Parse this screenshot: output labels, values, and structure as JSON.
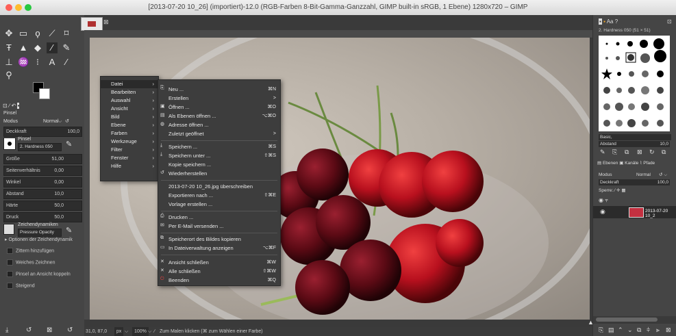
{
  "window": {
    "title": "[2013-07-20 10_26] (importiert)-12.0 (RGB-Farben 8-Bit-Gamma-Ganzzahl, GIMP built-in sRGB, 1 Ebene) 1280x720 – GIMP"
  },
  "tool_options": {
    "tool_name": "Pinsel",
    "mode_label": "Modus",
    "mode_value": "Normal",
    "opacity_label": "Deckkraft",
    "opacity_value": "100,0",
    "brush_label": "Pinsel",
    "brush_value": "2. Hardness 050",
    "rows": [
      {
        "label": "Größe",
        "value": "51,00"
      },
      {
        "label": "Seitenverhältnis",
        "value": "0,00"
      },
      {
        "label": "Winkel",
        "value": "0,00"
      },
      {
        "label": "Abstand",
        "value": "10,0"
      },
      {
        "label": "Härte",
        "value": "50,0"
      },
      {
        "label": "Druck",
        "value": "50,0"
      }
    ],
    "dynamics_label": "Zeichendynamiken",
    "dynamics_value": "Pressure Opacity",
    "options": [
      "Optionen der Zeichendynamik",
      "Zittern hinzufügen",
      "Weiches Zeichnen",
      "Pinsel an Ansicht koppeln",
      "Steigend"
    ]
  },
  "main_menu": {
    "items": [
      "Datei",
      "Bearbeiten",
      "Auswahl",
      "Ansicht",
      "Bild",
      "Ebene",
      "Farben",
      "Werkzeuge",
      "Filter",
      "Fenster",
      "Hilfe"
    ]
  },
  "file_menu": {
    "items": [
      {
        "label": "Neu ...",
        "key": "⌘N"
      },
      {
        "label": "Erstellen",
        "key": ">"
      },
      {
        "label": "Öffnen ...",
        "key": "⌘O"
      },
      {
        "label": "Als Ebenen öffnen ...",
        "key": "⌥⌘O"
      },
      {
        "label": "Adresse öffnen ...",
        "key": ""
      },
      {
        "label": "Zuletzt geöffnet",
        "key": ">"
      },
      {
        "label": "Speichern ...",
        "key": "⌘S"
      },
      {
        "label": "Speichern unter ...",
        "key": "⇧⌘S"
      },
      {
        "label": "Kopie speichern ...",
        "key": ""
      },
      {
        "label": "Wiederherstellen",
        "key": ""
      },
      {
        "label": "2013-07-20 10_26.jpg überschreiben",
        "key": ""
      },
      {
        "label": "Exportieren nach ...",
        "key": "⇧⌘E"
      },
      {
        "label": "Vorlage erstellen ...",
        "key": ""
      },
      {
        "label": "Drucken ...",
        "key": ""
      },
      {
        "label": "Per E-Mail versenden ...",
        "key": ""
      },
      {
        "label": "Speicherort des Bildes kopieren",
        "key": ""
      },
      {
        "label": "In Dateiverwaltung anzeigen",
        "key": "⌥⌘F"
      },
      {
        "label": "Ansicht schließen",
        "key": "⌘W"
      },
      {
        "label": "Alle schließen",
        "key": "⇧⌘W"
      },
      {
        "label": "Beenden",
        "key": "⌘Q"
      }
    ]
  },
  "brushes": {
    "header": "2. Hardness 050 (51 × 51)",
    "tag_label": "Basic,",
    "spacing_label": "Abstand",
    "spacing_value": "10,0"
  },
  "layers": {
    "tabs": [
      "Ebenen",
      "Kanäle",
      "Pfade"
    ],
    "mode_label": "Modus",
    "mode_value": "Normal",
    "opacity_label": "Deckkraft",
    "opacity_value": "100,0",
    "lock_label": "Sperre:",
    "layer_name": "2013-07-20 10_2"
  },
  "status": {
    "coords": "31,0, 87,0",
    "unit": "px",
    "zoom": "100%",
    "message": "Zum Malen klicken (⌘ zum Wählen einer Farbe)"
  }
}
